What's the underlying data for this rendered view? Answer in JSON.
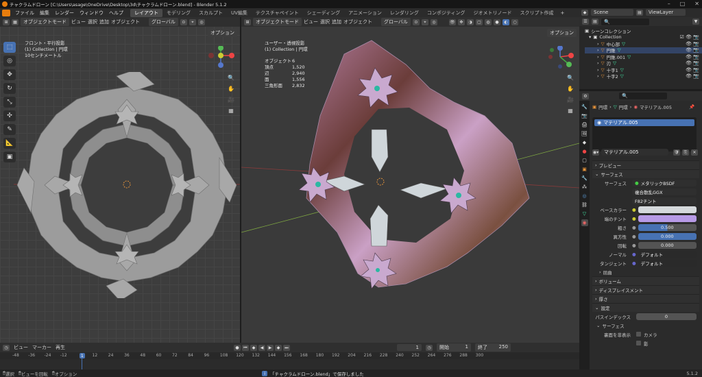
{
  "titlebar": {
    "title": "チャクラムドローン [C:\\Users\\asage\\OneDrive\\Desktop\\3d\\チャクラムドローン.blend] - Blender 5.1.2"
  },
  "menu": {
    "items": [
      "ファイル",
      "編集",
      "レンダー",
      "ウィンドウ",
      "ヘルプ"
    ]
  },
  "workspaces": [
    "レイアウト",
    "モデリング",
    "スカルプト",
    "UV編集",
    "テクスチャペイント",
    "シェーディング",
    "アニメーション",
    "レンダリング",
    "コンポジティング",
    "ジオメトリノード",
    "スクリプト作成"
  ],
  "topright": {
    "scene": "Scene",
    "viewlayer": "ViewLayer"
  },
  "vp_left": {
    "mode": "オブジェクトモード",
    "menus": [
      "ビュー",
      "選択",
      "追加",
      "オブジェクト"
    ],
    "transform": "グローバル",
    "options": "オプション",
    "info": [
      "フロント・平行投影",
      "(1) Collection | 円環",
      "10センチメートル"
    ]
  },
  "vp_right": {
    "mode": "オブジェクトモード",
    "menus": [
      "ビュー",
      "選択",
      "追加",
      "オブジェクト"
    ],
    "transform": "グローバル",
    "options": "オプション",
    "info": [
      "ユーザー・透視投影",
      "(1) Collection | 円環"
    ],
    "stats": [
      {
        "k": "オブジェクト",
        "v": "6"
      },
      {
        "k": "頂点",
        "v": "1,520"
      },
      {
        "k": "辺",
        "v": "2,940"
      },
      {
        "k": "面",
        "v": "1,556"
      },
      {
        "k": "三角形面",
        "v": "2,832"
      }
    ]
  },
  "outliner": {
    "search_placeholder": "",
    "root": "シーンコレクション",
    "collection": "Collection",
    "items": [
      "中心部",
      "円錐",
      "円錐.001",
      "刃",
      "十字1",
      "十字2"
    ]
  },
  "props": {
    "breadcrumb": [
      "円環",
      "円環",
      "マテリアル.005"
    ],
    "material_slot": "マテリアル.005",
    "material_name": "マテリアル.005",
    "panels": {
      "preview": "プレビュー",
      "surface": "サーフェス",
      "volume": "ボリューム",
      "displacement": "ディスプレイスメント",
      "thickness": "厚さ",
      "settings": "設定",
      "sub_surface": "サーフェス",
      "advanced": "屈曲"
    },
    "surface_label": "サーフェス",
    "surface_value": "メタリックBSDF",
    "dist": "複合散乱GGX",
    "tint": "F82チント",
    "rows": [
      {
        "label": "ベースカラー",
        "value": ""
      },
      {
        "label": "端のチント",
        "value": ""
      },
      {
        "label": "粗さ",
        "value": "0.500"
      },
      {
        "label": "異方性",
        "value": "0.000"
      },
      {
        "label": "回転",
        "value": "0.000"
      },
      {
        "label": "ノーマル",
        "value": "デフォルト"
      },
      {
        "label": "タンジェント",
        "value": "デフォルト"
      }
    ],
    "pass_label": "パスインデックス",
    "pass_value": "0",
    "backface_label": "裏面を非表示",
    "camera": "カメラ",
    "shadow": "影",
    "colors": {
      "base": "#d5d9dc",
      "edge": "#b79ae6",
      "bar": "#4772b3"
    }
  },
  "timeline": {
    "menus": [
      "ビュー",
      "マーカー",
      "再生"
    ],
    "current_frame": "1",
    "start_label": "開始",
    "start": "1",
    "end_label": "終了",
    "end": "250",
    "ticks": [
      "-48",
      "-36",
      "-24",
      "-12",
      "12",
      "24",
      "36",
      "48",
      "60",
      "72",
      "84",
      "96",
      "108",
      "120",
      "132",
      "144",
      "156",
      "168",
      "180",
      "192",
      "204",
      "216",
      "228",
      "240",
      "252",
      "264",
      "276",
      "288",
      "300"
    ],
    "playhead": "1"
  },
  "status": {
    "left": [
      "選択",
      "ビューを回転",
      "オプション"
    ],
    "message": "「チャクラムドローン.blend」で保存しました",
    "version": "5.1.2"
  }
}
